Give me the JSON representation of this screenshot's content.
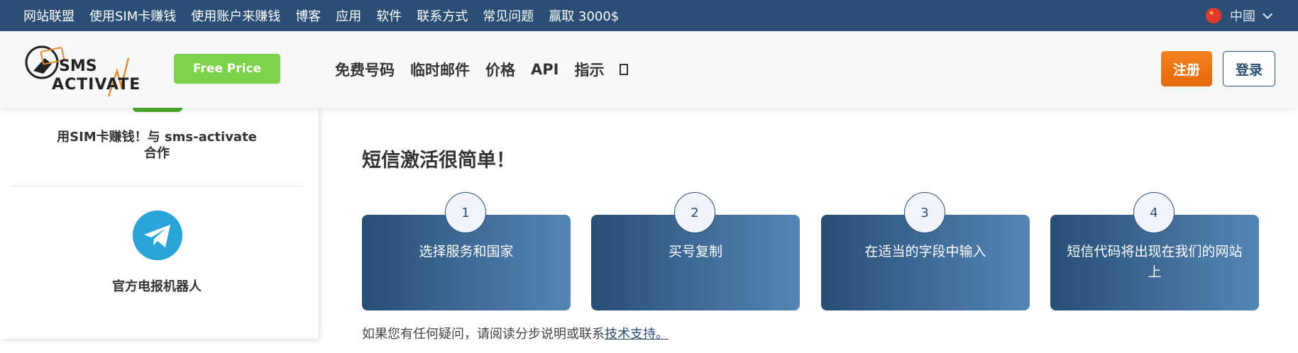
{
  "topbar": {
    "links": [
      "网站联盟",
      "使用SIM卡赚钱",
      "使用账户来赚钱",
      "博客",
      "应用",
      "软件",
      "联系方式",
      "常见问题",
      "赢取 3000$"
    ],
    "language": "中國"
  },
  "header": {
    "logo_top": "SMS",
    "logo_bottom": "ACTIVATE",
    "free_price_label": "Free Price",
    "nav": [
      "免费号码",
      "临时邮件",
      "价格",
      "API",
      "指示"
    ],
    "register_label": "注册",
    "login_label": "登录"
  },
  "sidebar": {
    "promo_line1": "用SIM卡赚钱！与 sms-activate",
    "promo_line2": "合作",
    "telegram_label": "官方电报机器人"
  },
  "main": {
    "title": "短信激活很简单！",
    "steps": [
      {
        "num": "1",
        "text": "选择服务和国家"
      },
      {
        "num": "2",
        "text": "买号复制"
      },
      {
        "num": "3",
        "text": "在适当的字段中输入"
      },
      {
        "num": "4",
        "text": "短信代码将出现在我们的网站上"
      }
    ],
    "help_text": "如果您有任何疑问，请阅读分步说明或联系",
    "help_link": "技术支持。"
  },
  "colors": {
    "topbar": "#2b4f74",
    "accent_green": "#7ed24a",
    "accent_orange": "#f58220",
    "step_gradient_start": "#274f76",
    "step_gradient_end": "#5585b5"
  },
  "icons": [
    "china-flag-icon",
    "chevron-down-icon",
    "telegram-icon",
    "external-box-icon"
  ]
}
